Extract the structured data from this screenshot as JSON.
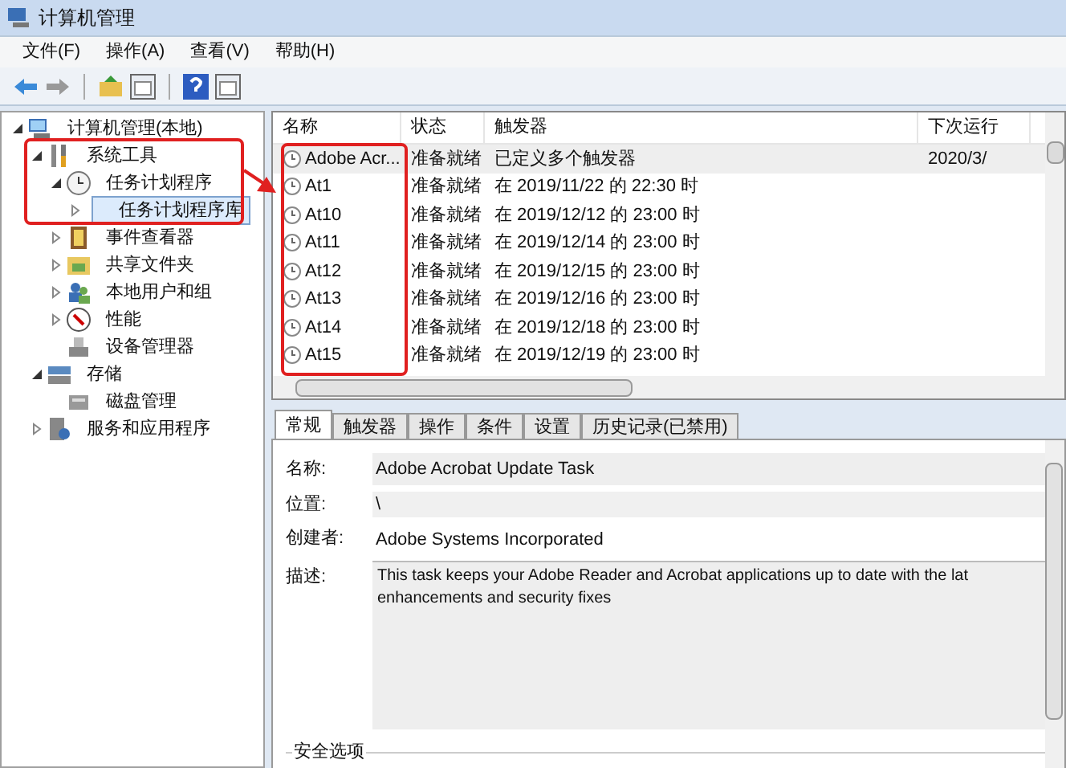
{
  "window": {
    "title": "计算机管理"
  },
  "menu": [
    "文件(F)",
    "操作(A)",
    "查看(V)",
    "帮助(H)"
  ],
  "tree": [
    {
      "label": "计算机管理(本地)",
      "kind": "computer",
      "selected": false,
      "expanded": true,
      "children": [
        {
          "label": "系统工具",
          "kind": "tools",
          "selected": false,
          "expanded": true,
          "children": [
            {
              "label": "任务计划程序",
              "kind": "clock",
              "selected": false,
              "expanded": true,
              "children": [
                {
                  "label": "任务计划程序库",
                  "selected": true,
                  "expanded": false
                }
              ]
            },
            {
              "label": "事件查看器",
              "kind": "log",
              "selected": false,
              "expanded": false
            },
            {
              "label": "共享文件夹",
              "kind": "share",
              "selected": false,
              "expanded": false
            },
            {
              "label": "本地用户和组",
              "kind": "users",
              "selected": false,
              "expanded": false
            },
            {
              "label": "性能",
              "kind": "gauge",
              "selected": false,
              "expanded": false
            },
            {
              "label": "设备管理器",
              "kind": "device",
              "selected": false
            }
          ]
        },
        {
          "label": "存储",
          "kind": "storage",
          "selected": false,
          "expanded": true,
          "children": [
            {
              "label": "磁盘管理",
              "kind": "disk",
              "selected": false
            }
          ]
        },
        {
          "label": "服务和应用程序",
          "kind": "services",
          "selected": false,
          "expanded": false
        }
      ]
    }
  ],
  "table": {
    "columns": [
      "名称",
      "状态",
      "触发器",
      "下次运行"
    ],
    "rows": [
      {
        "name": "Adobe Acr...",
        "status": "准备就绪",
        "trigger": "已定义多个触发器",
        "next": "2020/3/",
        "selected": true
      },
      {
        "name": "At1",
        "status": "准备就绪",
        "trigger": "在 2019/11/22 的 22:30 时",
        "selected": false
      },
      {
        "name": "At10",
        "status": "准备就绪",
        "trigger": "在 2019/12/12 的 23:00 时",
        "selected": false
      },
      {
        "name": "At11",
        "status": "准备就绪",
        "trigger": "在 2019/12/14 的 23:00 时",
        "selected": false
      },
      {
        "name": "At12",
        "status": "准备就绪",
        "trigger": "在 2019/12/15 的 23:00 时",
        "selected": false
      },
      {
        "name": "At13",
        "status": "准备就绪",
        "trigger": "在 2019/12/16 的 23:00 时",
        "selected": false
      },
      {
        "name": "At14",
        "status": "准备就绪",
        "trigger": "在 2019/12/18 的 23:00 时",
        "selected": false
      },
      {
        "name": "At15",
        "status": "准备就绪",
        "trigger": "在 2019/12/19 的 23:00 时",
        "selected": false
      }
    ]
  },
  "tabs": [
    {
      "label": "常规",
      "selected": true
    },
    {
      "label": "触发器",
      "selected": false
    },
    {
      "label": "操作",
      "selected": false
    },
    {
      "label": "条件",
      "selected": false
    },
    {
      "label": "设置",
      "selected": false
    },
    {
      "label": "历史记录(已禁用)",
      "selected": false
    }
  ],
  "general": {
    "name_label": "名称:",
    "name": "Adobe Acrobat Update Task",
    "location_label": "位置:",
    "location": "\\",
    "author_label": "创建者:",
    "author": "Adobe Systems Incorporated",
    "description_label": "描述:",
    "description": "This task keeps your Adobe Reader and Acrobat applications up to date with the lat\nenhancements and security fixes",
    "security_label": "安全选项"
  }
}
